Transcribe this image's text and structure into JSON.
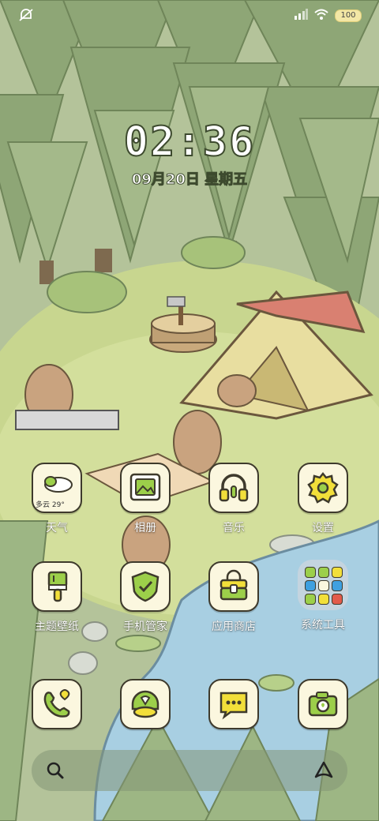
{
  "status": {
    "battery": "100"
  },
  "clock": {
    "time": "02:36",
    "date": "09月20日 星期五"
  },
  "apps": [
    {
      "id": "weather",
      "label": "天气",
      "temp": "多云 29°"
    },
    {
      "id": "gallery",
      "label": "相册"
    },
    {
      "id": "music",
      "label": "音乐"
    },
    {
      "id": "settings",
      "label": "设置"
    },
    {
      "id": "themes",
      "label": "主题壁纸"
    },
    {
      "id": "security",
      "label": "手机管家"
    },
    {
      "id": "appstore",
      "label": "应用商店"
    },
    {
      "id": "tools",
      "label": "系统工具"
    }
  ],
  "dock_apps": [
    {
      "id": "phone"
    },
    {
      "id": "browser"
    },
    {
      "id": "messages"
    },
    {
      "id": "camera"
    }
  ],
  "colors": {
    "icon_bg": "#fbf7df",
    "icon_outline": "#3e3a2c",
    "accent_green": "#9ccf4a",
    "accent_yellow": "#f2df3a"
  },
  "icons": {
    "status_left": "silent-mode-icon",
    "signal": "signal-bars-icon",
    "wifi": "wifi-icon",
    "search": "search-icon",
    "assistant": "assistant-icon"
  }
}
